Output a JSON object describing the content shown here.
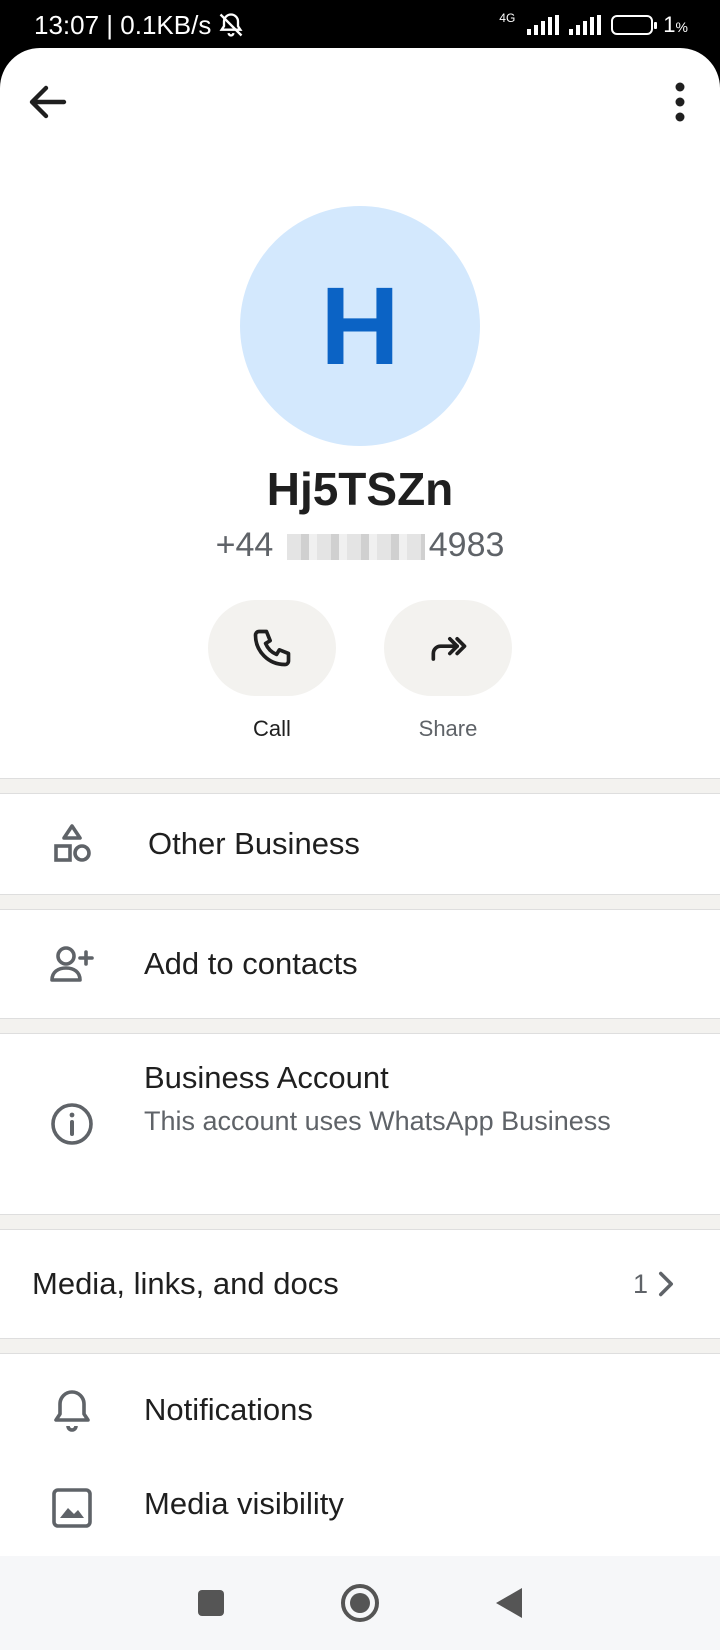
{
  "status_bar": {
    "time_speed": "13:07 | 0.1KB/s",
    "network": "4G",
    "battery": "1"
  },
  "contact": {
    "avatar_letter": "H",
    "name": "Hj5TSZn",
    "phone_prefix": "+44",
    "phone_suffix": "4983"
  },
  "actions": {
    "call_label": "Call",
    "share_label": "Share"
  },
  "rows": {
    "other_business": "Other Business",
    "add_contacts": "Add to contacts",
    "business_title": "Business Account",
    "business_desc": "This account uses WhatsApp Business",
    "media_label": "Media, links, and docs",
    "media_count": "1",
    "notifications": "Notifications",
    "media_visibility": "Media visibility"
  },
  "colors": {
    "avatar_bg": "#d3e8fd",
    "avatar_fg": "#0b63c5",
    "button_bg": "#f3f2ef"
  }
}
